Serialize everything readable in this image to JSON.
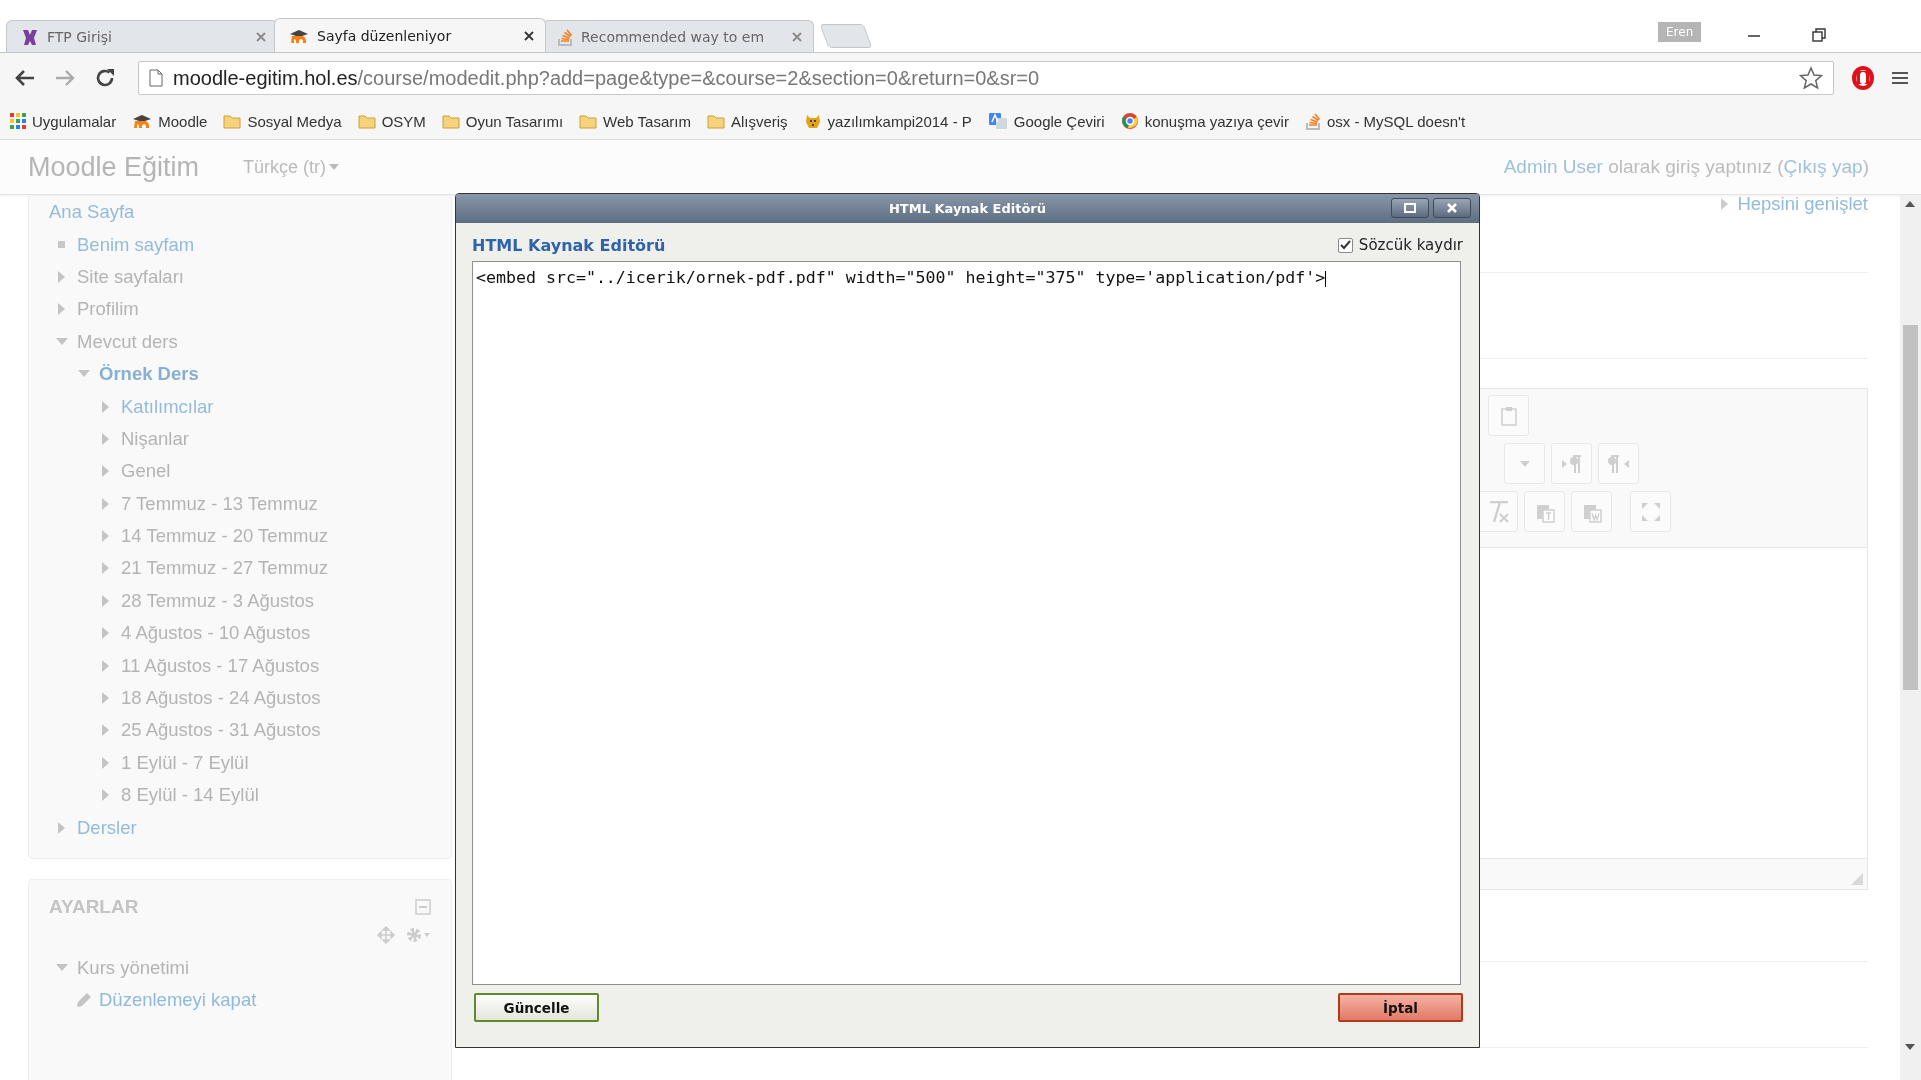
{
  "browser": {
    "tabs": [
      {
        "title": "FTP Girişi",
        "kind": "site",
        "selected": false
      },
      {
        "title": "Sayfa düzenleniyor",
        "kind": "moodle",
        "selected": true
      },
      {
        "title": "Recommended way to em",
        "kind": "stack",
        "selected": false
      }
    ],
    "profile": "Eren",
    "url": {
      "host": "moodle-egitim.hol.es",
      "path": "/course/modedit.php?add=page&type=&course=2&section=0&return=0&sr=0"
    },
    "bookmarks": [
      {
        "label": "Uygulamalar",
        "kind": "apps"
      },
      {
        "label": "Moodle",
        "kind": "moodle"
      },
      {
        "label": "Sosyal Medya",
        "kind": "folder"
      },
      {
        "label": "OSYM",
        "kind": "folder"
      },
      {
        "label": "Oyun Tasarımı",
        "kind": "folder"
      },
      {
        "label": "Web Tasarım",
        "kind": "folder"
      },
      {
        "label": "Alışveriş",
        "kind": "folder"
      },
      {
        "label": "yazılımkampi2014 - P",
        "kind": "tiger"
      },
      {
        "label": "Google Çeviri",
        "kind": "translate"
      },
      {
        "label": "konuşma yazıya çevir",
        "kind": "chrome"
      },
      {
        "label": "osx - MySQL doesn't",
        "kind": "stack"
      }
    ]
  },
  "site": {
    "brand": "Moodle Eğitim",
    "language": "Türkçe (tr)",
    "login": {
      "user": "Admin User",
      "text": "olarak giriş yaptınız (",
      "logout": "Çıkış yap",
      "close": ")"
    },
    "expand_all": "Hepsini genişlet"
  },
  "navigation": {
    "home": "Ana Sayfa",
    "items": [
      {
        "label": "Benim sayfam",
        "kind": "leaf"
      },
      {
        "label": "Site sayfaları",
        "kind": "text",
        "expanded": false
      },
      {
        "label": "Profilim",
        "kind": "text",
        "expanded": false
      },
      {
        "label": "Mevcut ders",
        "kind": "text",
        "expanded": true,
        "children": [
          {
            "label": "Örnek Ders",
            "kind": "current",
            "expanded": true,
            "children": [
              {
                "label": "Katılımcılar",
                "kind": "link",
                "expanded": false
              },
              {
                "label": "Nişanlar",
                "kind": "text",
                "expanded": false
              },
              {
                "label": "Genel",
                "kind": "text",
                "expanded": false
              },
              {
                "label": "7 Temmuz - 13 Temmuz",
                "kind": "text",
                "expanded": false
              },
              {
                "label": "14 Temmuz - 20 Temmuz",
                "kind": "text",
                "expanded": false
              },
              {
                "label": "21 Temmuz - 27 Temmuz",
                "kind": "text",
                "expanded": false
              },
              {
                "label": "28 Temmuz - 3 Ağustos",
                "kind": "text",
                "expanded": false
              },
              {
                "label": "4 Ağustos - 10 Ağustos",
                "kind": "text",
                "expanded": false
              },
              {
                "label": "11 Ağustos - 17 Ağustos",
                "kind": "text",
                "expanded": false
              },
              {
                "label": "18 Ağustos - 24 Ağustos",
                "kind": "text",
                "expanded": false
              },
              {
                "label": "25 Ağustos - 31 Ağustos",
                "kind": "text",
                "expanded": false
              },
              {
                "label": "1 Eylül - 7 Eylül",
                "kind": "text",
                "expanded": false
              },
              {
                "label": "8 Eylül - 14 Eylül",
                "kind": "text",
                "expanded": false
              }
            ]
          }
        ]
      },
      {
        "label": "Dersler",
        "kind": "link",
        "expanded": false
      }
    ]
  },
  "settings": {
    "title": "AYARLAR",
    "items": [
      {
        "label": "Kurs yönetimi",
        "kind": "text",
        "expanded": true,
        "children": [
          {
            "label": "Düzenlemeyi kapat",
            "kind": "edit"
          }
        ]
      }
    ]
  },
  "dialog": {
    "title": "HTML Kaynak Editörü",
    "heading": "HTML Kaynak Editörü",
    "wrap": {
      "label": "Sözcük kaydır",
      "checked": true
    },
    "source": "<embed src=\"../icerik/ornek-pdf.pdf\" width=\"500\" height=\"375\" type='application/pdf'>",
    "buttons": [
      {
        "label": "Güncelle",
        "kind": "update"
      },
      {
        "label": "İptal",
        "kind": "cancel"
      }
    ]
  }
}
